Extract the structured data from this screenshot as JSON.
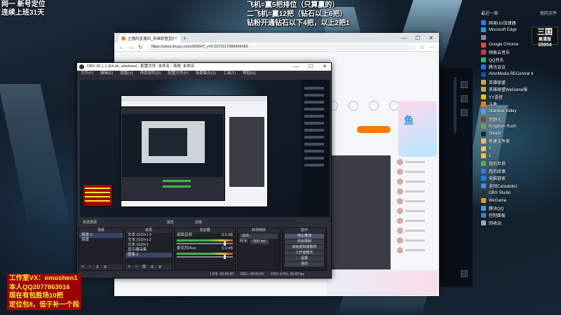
{
  "overlay": {
    "top_left": [
      "网一 新号定位",
      "连续上班31天"
    ],
    "top_center": [
      "飞机=赢5把排位（只算赢的）",
      "二飞机=赢12把（钻石以上6把）",
      "钻粉开通钻石以下4把，以上2把1"
    ],
    "bottom_left": [
      "工作室VX：emoshen1",
      "本人QQ2077863016",
      "现在有包胜场10把",
      "定位包8，低于补一个段"
    ]
  },
  "desktop": {
    "header_left": "最近一周",
    "header_right": "我的文件",
    "icons": [
      {
        "label": "网易UU加速器",
        "color": "#2a7de1"
      },
      {
        "label": "Microsoft Edge",
        "color": "#1aa0d8"
      },
      {
        "label": "",
        "color": "#888"
      },
      {
        "label": "Google Chrome",
        "color": "#e04a3a"
      },
      {
        "label": "网易云音乐",
        "color": "#d33"
      },
      {
        "label": "QQ音乐",
        "color": "#2bb673"
      },
      {
        "label": "腾讯会议",
        "color": "#2a6de1"
      },
      {
        "label": "AVerMedia RECentral 4",
        "color": "#1b4f9a"
      },
      {
        "label": "英雄联盟",
        "color": "#c9a64a"
      },
      {
        "label": "英雄联盟WeGame版",
        "color": "#c9a64a"
      },
      {
        "label": "YY语音",
        "color": "#f2c200"
      },
      {
        "label": "斗鱼",
        "color": "#ff7a00"
      },
      {
        "label": "Stardew Valley",
        "color": "#5aa0d0"
      },
      {
        "label": "荒野大",
        "color": "#7a4b2a"
      },
      {
        "label": "Kingdom Rush",
        "color": "#7aa040"
      },
      {
        "label": "Steam",
        "color": "#1b2838"
      },
      {
        "label": "新建文件夹",
        "color": "#e8c25a"
      },
      {
        "label": "1",
        "color": "#e8c25a"
      },
      {
        "label": "1",
        "color": "#e8c25a"
      },
      {
        "label": "我的世界",
        "color": "#6aa84f"
      },
      {
        "label": "我的故事",
        "color": "#3c78d8"
      },
      {
        "label": "电脑管家",
        "color": "#2a7de1"
      },
      {
        "label": "迪拜Cantabile2",
        "color": "#4a86e8"
      },
      {
        "label": "OBS Studio",
        "color": "#302e31"
      },
      {
        "label": "WeGame",
        "color": "#e0a020"
      },
      {
        "label": "腾讯QQ",
        "color": "#3aa0e8"
      },
      {
        "label": "控制面板",
        "color": "#4a7ab8"
      },
      {
        "label": "回收站",
        "color": "#9aa8b8"
      }
    ],
    "badge": {
      "title": "三国",
      "subtitle": "高清版",
      "number": "35954"
    }
  },
  "browser": {
    "tab_title": "主播的直播间_英雄联盟直播_斗鱼",
    "new_tab": "+",
    "url": "https://www.douyu.com/35954?_r=0.2371617088456465",
    "window_controls": [
      "—",
      "☐",
      "✕"
    ]
  },
  "obs": {
    "title": "OBS 26.1.1 (64-bit, windows) - 配置文件: 未命名 - 场景: 未命名",
    "window_controls": [
      "—",
      "☐",
      "✕"
    ],
    "menu": [
      "文件(F)",
      "编辑(E)",
      "视图(V)",
      "停靠部件(D)",
      "配置文件(P)",
      "场景集合(S)",
      "工具(T)",
      "帮助(H)"
    ],
    "status_labels": [
      "未选择源",
      "属性",
      "滤镜"
    ],
    "docks": {
      "scenes": {
        "header": "场景",
        "items": [
          "场景 2",
          "场景"
        ]
      },
      "sources": {
        "header": "来源",
        "items": [
          "文本 (GDI+) 3",
          "文本 (GDI+) 2",
          "文本 (GDI+)",
          "显示器采集",
          "图像 2"
        ]
      },
      "mixer": {
        "header": "混音器",
        "channels": [
          {
            "name": "桌面音频",
            "db": "0.0 dB"
          },
          {
            "name": "麦克风/Aux",
            "db": "0.0 dB"
          }
        ]
      },
      "transitions": {
        "header": "转场特效",
        "type": "淡出",
        "duration_label": "时长",
        "duration": "300 ms"
      },
      "controls": {
        "header": "控件",
        "buttons": [
          "停止推流",
          "开始录制",
          "启动虚拟摄像机",
          "工作室模式",
          "设置",
          "退出"
        ]
      }
    },
    "footer": [
      "LIVE: 00:00:00",
      "REC: 00:00:00",
      "CPU: 6.0%, 30.00 fps"
    ]
  }
}
